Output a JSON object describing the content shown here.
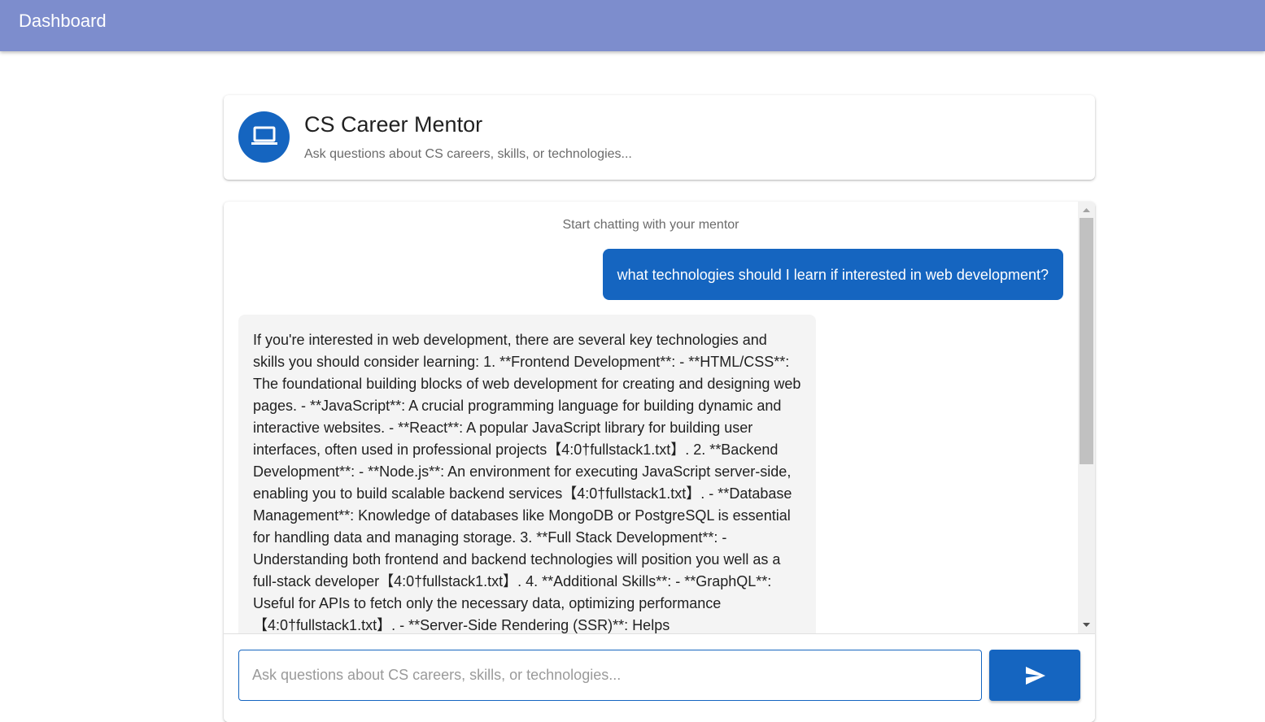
{
  "appbar": {
    "title": "Dashboard"
  },
  "mentor": {
    "title": "CS Career Mentor",
    "subtitle": "Ask questions about CS careers, skills, or technologies...",
    "avatar_icon": "laptop-icon"
  },
  "chat": {
    "start_note": "Start chatting with your mentor",
    "messages": [
      {
        "role": "user",
        "text": "what technologies should I learn if interested in web development?"
      },
      {
        "role": "assistant",
        "text": "If you're interested in web development, there are several key technologies and skills you should consider learning: 1. **Frontend Development**: - **HTML/CSS**: The foundational building blocks of web development for creating and designing web pages. - **JavaScript**: A crucial programming language for building dynamic and interactive websites. - **React**: A popular JavaScript library for building user interfaces, often used in professional projects【4:0†fullstack1.txt】. 2. **Backend Development**: - **Node.js**: An environment for executing JavaScript server-side, enabling you to build scalable backend services【4:0†fullstack1.txt】. - **Database Management**: Knowledge of databases like MongoDB or PostgreSQL is essential for handling data and managing storage. 3. **Full Stack Development**: - Understanding both frontend and backend technologies will position you well as a full-stack developer【4:0†fullstack1.txt】. 4. **Additional Skills**: - **GraphQL**: Useful for APIs to fetch only the necessary data, optimizing performance【4:0†fullstack1.txt】. - **Server-Side Rendering (SSR)**: Helps"
      }
    ]
  },
  "input": {
    "placeholder": "Ask questions about CS careers, skills, or technologies...",
    "value": "",
    "send_icon": "send-icon"
  },
  "colors": {
    "appbar": "#7d8dcd",
    "primary": "#1565c0",
    "assistant_bubble": "#f4f4f4"
  }
}
